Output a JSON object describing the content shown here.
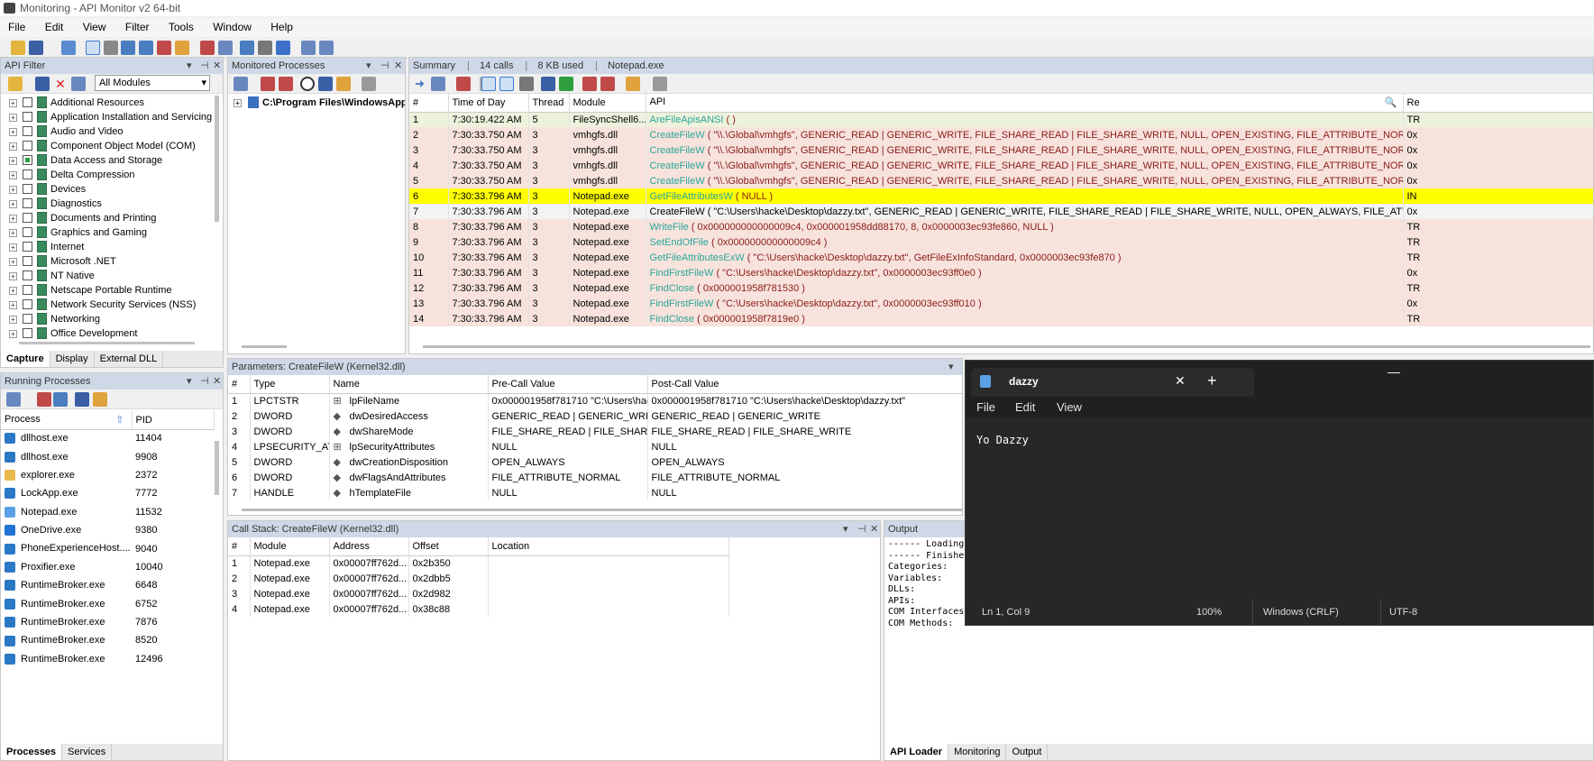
{
  "window": {
    "title": "Monitoring - API Monitor v2 64-bit"
  },
  "menu": [
    "File",
    "Edit",
    "View",
    "Filter",
    "Tools",
    "Window",
    "Help"
  ],
  "api_filter": {
    "title": "API Filter",
    "modules_select": "All Modules",
    "items": [
      "Additional Resources",
      "Application Installation and Servicing",
      "Audio and Video",
      "Component Object Model (COM)",
      "Data Access and Storage",
      "Delta Compression",
      "Devices",
      "Diagnostics",
      "Documents and Printing",
      "Graphics and Gaming",
      "Internet",
      "Microsoft .NET",
      "NT Native",
      "Netscape Portable Runtime",
      "Network Security Services (NSS)",
      "Networking",
      "Office Development"
    ],
    "tabs": [
      "Capture",
      "Display",
      "External DLL"
    ]
  },
  "monitored": {
    "title": "Monitored Processes",
    "path": "C:\\Program Files\\WindowsApps\\M"
  },
  "summary": {
    "header": {
      "label": "Summary",
      "calls": "14 calls",
      "used": "8 KB used",
      "module": "Notepad.exe"
    },
    "columns": [
      "#",
      "Time of Day",
      "Thread",
      "Module",
      "API",
      "Re"
    ],
    "rows": [
      {
        "n": "1",
        "time": "7:30:19.422 AM",
        "thread": "5",
        "module": "FileSyncShell6...",
        "api": "AreFileApisANSI",
        "args": "( )",
        "ret": "TR"
      },
      {
        "n": "2",
        "time": "7:30:33.750 AM",
        "thread": "3",
        "module": "vmhgfs.dll",
        "api": "CreateFileW",
        "args": "( \"\\\\.\\Global\\vmhgfs\", GENERIC_READ | GENERIC_WRITE, FILE_SHARE_READ | FILE_SHARE_WRITE, NULL, OPEN_EXISTING, FILE_ATTRIBUTE_NORMAL, NULL )",
        "ret": "0x"
      },
      {
        "n": "3",
        "time": "7:30:33.750 AM",
        "thread": "3",
        "module": "vmhgfs.dll",
        "api": "CreateFileW",
        "args": "( \"\\\\.\\Global\\vmhgfs\", GENERIC_READ | GENERIC_WRITE, FILE_SHARE_READ | FILE_SHARE_WRITE, NULL, OPEN_EXISTING, FILE_ATTRIBUTE_NORMAL, NULL )",
        "ret": "0x"
      },
      {
        "n": "4",
        "time": "7:30:33.750 AM",
        "thread": "3",
        "module": "vmhgfs.dll",
        "api": "CreateFileW",
        "args": "( \"\\\\.\\Global\\vmhgfs\", GENERIC_READ | GENERIC_WRITE, FILE_SHARE_READ | FILE_SHARE_WRITE, NULL, OPEN_EXISTING, FILE_ATTRIBUTE_NORMAL, NULL )",
        "ret": "0x"
      },
      {
        "n": "5",
        "time": "7:30:33.750 AM",
        "thread": "3",
        "module": "vmhgfs.dll",
        "api": "CreateFileW",
        "args": "( \"\\\\.\\Global\\vmhgfs\", GENERIC_READ | GENERIC_WRITE, FILE_SHARE_READ | FILE_SHARE_WRITE, NULL, OPEN_EXISTING, FILE_ATTRIBUTE_NORMAL, NULL )",
        "ret": "0x"
      },
      {
        "n": "6",
        "time": "7:30:33.796 AM",
        "thread": "3",
        "module": "Notepad.exe",
        "api": "GetFileAttributesW",
        "args": "( NULL )",
        "ret": "IN"
      },
      {
        "n": "7",
        "time": "7:30:33.796 AM",
        "thread": "3",
        "module": "Notepad.exe",
        "api": "CreateFileW",
        "args": "( \"C:\\Users\\hacke\\Desktop\\dazzy.txt\", GENERIC_READ | GENERIC_WRITE, FILE_SHARE_READ | FILE_SHARE_WRITE, NULL, OPEN_ALWAYS, FILE_ATTRIBUTE_NORMAL, NULL )",
        "ret": "0x"
      },
      {
        "n": "8",
        "time": "7:30:33.796 AM",
        "thread": "3",
        "module": "Notepad.exe",
        "api": "WriteFile",
        "args": "( 0x000000000000009c4, 0x000001958dd88170, 8, 0x0000003ec93fe860, NULL )",
        "ret": "TR"
      },
      {
        "n": "9",
        "time": "7:30:33.796 AM",
        "thread": "3",
        "module": "Notepad.exe",
        "api": "SetEndOfFile",
        "args": "( 0x000000000000009c4 )",
        "ret": "TR"
      },
      {
        "n": "10",
        "time": "7:30:33.796 AM",
        "thread": "3",
        "module": "Notepad.exe",
        "api": "GetFileAttributesExW",
        "args": "( \"C:\\Users\\hacke\\Desktop\\dazzy.txt\", GetFileExInfoStandard, 0x0000003ec93fe870 )",
        "ret": "TR"
      },
      {
        "n": "11",
        "time": "7:30:33.796 AM",
        "thread": "3",
        "module": "Notepad.exe",
        "api": "FindFirstFileW",
        "args": "( \"C:\\Users\\hacke\\Desktop\\dazzy.txt\", 0x0000003ec93ff0e0 )",
        "ret": "0x"
      },
      {
        "n": "12",
        "time": "7:30:33.796 AM",
        "thread": "3",
        "module": "Notepad.exe",
        "api": "FindClose",
        "args": "( 0x000001958f781530 )",
        "ret": "TR"
      },
      {
        "n": "13",
        "time": "7:30:33.796 AM",
        "thread": "3",
        "module": "Notepad.exe",
        "api": "FindFirstFileW",
        "args": "( \"C:\\Users\\hacke\\Desktop\\dazzy.txt\", 0x0000003ec93ff010 )",
        "ret": "0x"
      },
      {
        "n": "14",
        "time": "7:30:33.796 AM",
        "thread": "3",
        "module": "Notepad.exe",
        "api": "FindClose",
        "args": "( 0x000001958f7819e0 )",
        "ret": "TR"
      }
    ]
  },
  "params": {
    "title": "Parameters: CreateFileW (Kernel32.dll)",
    "columns": [
      "#",
      "Type",
      "Name",
      "Pre-Call Value",
      "Post-Call Value"
    ],
    "rows": [
      {
        "n": "1",
        "type": "LPCTSTR",
        "name": "lpFileName",
        "pre": "0x000001958f781710 \"C:\\Users\\hack...",
        "post": "0x000001958f781710 \"C:\\Users\\hacke\\Desktop\\dazzy.txt\""
      },
      {
        "n": "2",
        "type": "DWORD",
        "name": "dwDesiredAccess",
        "pre": "GENERIC_READ | GENERIC_WRITE",
        "post": "GENERIC_READ | GENERIC_WRITE"
      },
      {
        "n": "3",
        "type": "DWORD",
        "name": "dwShareMode",
        "pre": "FILE_SHARE_READ | FILE_SHARE_W...",
        "post": "FILE_SHARE_READ | FILE_SHARE_WRITE"
      },
      {
        "n": "4",
        "type": "LPSECURITY_AT...",
        "name": "lpSecurityAttributes",
        "pre": "NULL",
        "post": "NULL"
      },
      {
        "n": "5",
        "type": "DWORD",
        "name": "dwCreationDisposition",
        "pre": "OPEN_ALWAYS",
        "post": "OPEN_ALWAYS"
      },
      {
        "n": "6",
        "type": "DWORD",
        "name": "dwFlagsAndAttributes",
        "pre": "FILE_ATTRIBUTE_NORMAL",
        "post": "FILE_ATTRIBUTE_NORMAL"
      },
      {
        "n": "7",
        "type": "HANDLE",
        "name": "hTemplateFile",
        "pre": "NULL",
        "post": "NULL"
      }
    ]
  },
  "callstack": {
    "title": "Call Stack: CreateFileW (Kernel32.dll)",
    "columns": [
      "#",
      "Module",
      "Address",
      "Offset",
      "Location"
    ],
    "rows": [
      {
        "n": "1",
        "module": "Notepad.exe",
        "address": "0x00007ff762d...",
        "offset": "0x2b350"
      },
      {
        "n": "2",
        "module": "Notepad.exe",
        "address": "0x00007ff762d...",
        "offset": "0x2dbb5"
      },
      {
        "n": "3",
        "module": "Notepad.exe",
        "address": "0x00007ff762d...",
        "offset": "0x2d982"
      },
      {
        "n": "4",
        "module": "Notepad.exe",
        "address": "0x00007ff762d...",
        "offset": "0x38c88"
      }
    ]
  },
  "running": {
    "title": "Running Processes",
    "columns": [
      "Process",
      "PID"
    ],
    "rows": [
      {
        "name": "dllhost.exe",
        "pid": "11404"
      },
      {
        "name": "dllhost.exe",
        "pid": "9908"
      },
      {
        "name": "explorer.exe",
        "pid": "2372"
      },
      {
        "name": "LockApp.exe",
        "pid": "7772"
      },
      {
        "name": "Notepad.exe",
        "pid": "11532"
      },
      {
        "name": "OneDrive.exe",
        "pid": "9380"
      },
      {
        "name": "PhoneExperienceHost....",
        "pid": "9040"
      },
      {
        "name": "Proxifier.exe",
        "pid": "10040"
      },
      {
        "name": "RuntimeBroker.exe",
        "pid": "6648"
      },
      {
        "name": "RuntimeBroker.exe",
        "pid": "6752"
      },
      {
        "name": "RuntimeBroker.exe",
        "pid": "7876"
      },
      {
        "name": "RuntimeBroker.exe",
        "pid": "8520"
      },
      {
        "name": "RuntimeBroker.exe",
        "pid": "12496"
      }
    ],
    "tabs": [
      "Processes",
      "Services"
    ]
  },
  "output": {
    "title": "Output",
    "lines": [
      "------ Loading",
      "------ Finishe",
      "Categories:",
      "Variables:",
      "DLLs:",
      "APIs:",
      "COM Interfaces",
      "COM Methods:"
    ],
    "tabs": [
      "API Loader",
      "Monitoring",
      "Output"
    ]
  },
  "notepad": {
    "tab_title": "dazzy",
    "menu": [
      "File",
      "Edit",
      "View"
    ],
    "content": "Yo Dazzy",
    "status": {
      "position": "Ln 1, Col 9",
      "zoom": "100%",
      "eol": "Windows (CRLF)",
      "encoding": "UTF-8"
    }
  }
}
